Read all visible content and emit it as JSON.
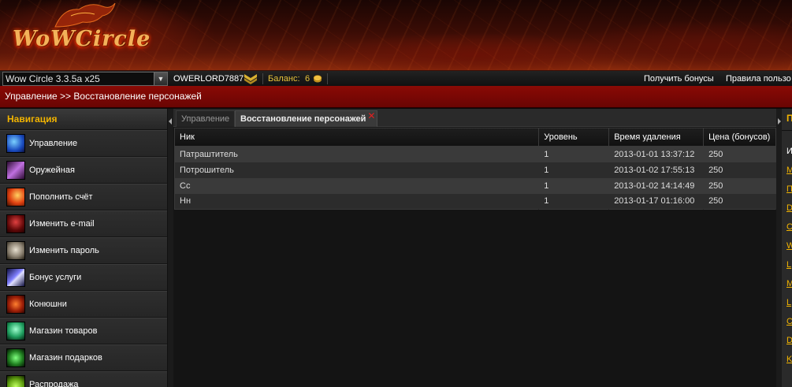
{
  "header": {
    "logo_text": "WoWCircle"
  },
  "topbar": {
    "realm_selected": "Wow Circle 3.3.5a x25",
    "username": "OWERLORD7887",
    "balance_label": "Баланс:",
    "balance_value": "6",
    "get_bonus": "Получить бонусы",
    "user_panel": "Правила пользо"
  },
  "breadcrumb": "Управление >> Восстановление персонажей",
  "nav": {
    "title": "Навигация",
    "items": [
      {
        "label": "Управление",
        "icon": "management-icon"
      },
      {
        "label": "Оружейная",
        "icon": "armory-icon"
      },
      {
        "label": "Пополнить счёт",
        "icon": "top-up-icon"
      },
      {
        "label": "Изменить e-mail",
        "icon": "email-icon"
      },
      {
        "label": "Изменить пароль",
        "icon": "password-icon"
      },
      {
        "label": "Бонус услуги",
        "icon": "bonus-services-icon"
      },
      {
        "label": "Конюшни",
        "icon": "stables-icon"
      },
      {
        "label": "Магазин товаров",
        "icon": "shop-icon"
      },
      {
        "label": "Магазин подарков",
        "icon": "gift-shop-icon"
      },
      {
        "label": "Распродажа",
        "icon": "sale-icon"
      }
    ]
  },
  "tabs": [
    {
      "label": "Управление",
      "active": false
    },
    {
      "label": "Восстановление персонажей",
      "active": true
    }
  ],
  "table": {
    "columns": [
      "Ник",
      "Уровень",
      "Время удаления",
      "Цена (бонусов)"
    ],
    "rows": [
      [
        "Патраштитель",
        "1",
        "2013-01-01 13:37:12",
        "250"
      ],
      [
        "Потрошитель",
        "1",
        "2013-01-02 17:55:13",
        "250"
      ],
      [
        "Сс",
        "1",
        "2013-01-02 14:14:49",
        "250"
      ],
      [
        "Нн",
        "1",
        "2013-01-17 01:16:00",
        "250"
      ]
    ]
  },
  "right_panel": {
    "title": "П",
    "col": "И",
    "links": [
      "М",
      "П",
      "D",
      "С",
      "W",
      "L",
      "М",
      "L",
      "С",
      "D",
      "K"
    ]
  },
  "colors": {
    "accent_gold": "#f2b400",
    "crumb_red": "#8a0a05",
    "tab_close": "#e02020"
  }
}
